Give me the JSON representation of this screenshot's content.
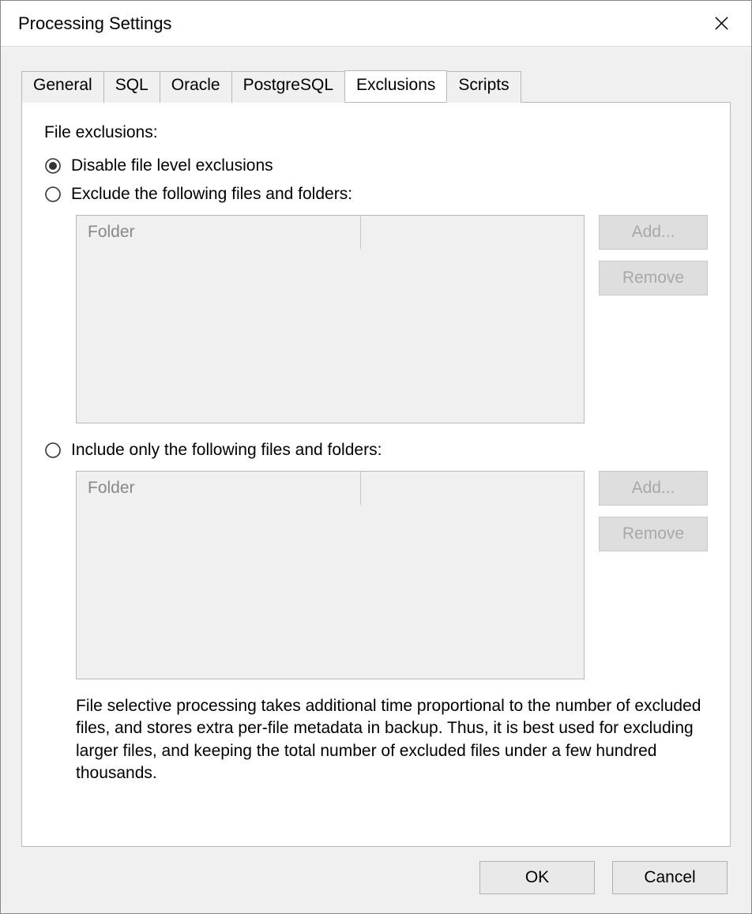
{
  "window": {
    "title": "Processing Settings"
  },
  "tabs": {
    "general": "General",
    "sql": "SQL",
    "oracle": "Oracle",
    "postgresql": "PostgreSQL",
    "exclusions": "Exclusions",
    "scripts": "Scripts",
    "active": "exclusions"
  },
  "exclusions": {
    "title": "File exclusions:",
    "option_disable": "Disable file level exclusions",
    "option_exclude": "Exclude the following files and folders:",
    "option_include": "Include only the following files and folders:",
    "selected": "disable",
    "list_header": "Folder",
    "buttons": {
      "add": "Add...",
      "remove": "Remove"
    },
    "note": "File selective processing takes additional time proportional to the number of excluded files, and stores extra per-file metadata in backup. Thus, it is best used for excluding larger files, and keeping the total number of excluded files under a few hundred thousands."
  },
  "dialog": {
    "ok": "OK",
    "cancel": "Cancel"
  }
}
